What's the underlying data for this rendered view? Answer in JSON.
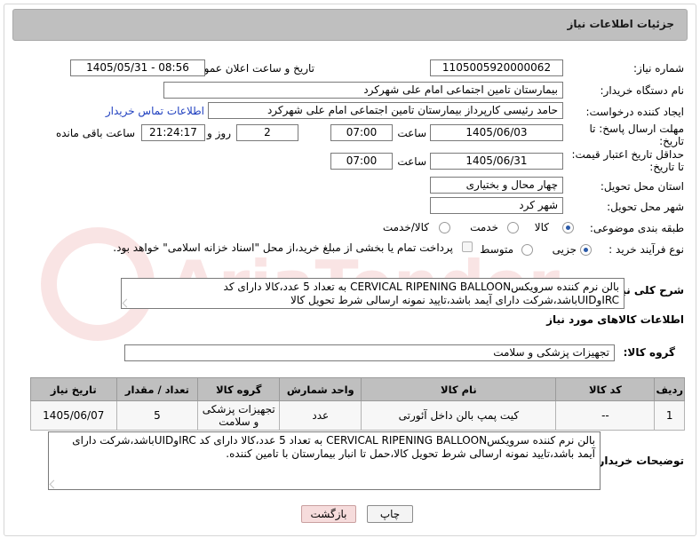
{
  "header": {
    "title": "جزئیات اطلاعات نیاز"
  },
  "fields": {
    "need_number_label": "شماره نیاز:",
    "need_number": "1105005920000062",
    "announce_label": "تاریخ و ساعت اعلان عمومی:",
    "announce_value": "1405/05/31 - 08:56",
    "buyer_org_label": "نام دستگاه خریدار:",
    "buyer_org": "بیمارستان تامین اجتماعی امام علی شهرکرد",
    "requester_label": "ایجاد کننده درخواست:",
    "requester": "حامد رئیسی کارپرداز بیمارستان تامین اجتماعی امام علی شهرکرد",
    "contact_link": "اطلاعات تماس خریدار",
    "deadline_label": "مهلت ارسال پاسخ: تا تاریخ:",
    "deadline_date": "1405/06/03",
    "time_label": "ساعت",
    "deadline_time": "07:00",
    "days_value": "2",
    "days_label": "روز و",
    "remaining_time": "21:24:17",
    "remaining_label": "ساعت باقی مانده",
    "validity_label": "حداقل تاریخ اعتبار قیمت: تا تاریخ:",
    "validity_date": "1405/06/31",
    "validity_time": "07:00",
    "province_label": "استان محل تحویل:",
    "province": "چهار محال و بختیاری",
    "city_label": "شهر محل تحویل:",
    "city": "شهر کرد",
    "category_label": "طبقه بندی موضوعی:",
    "category_options": [
      "کالا",
      "خدمت",
      "کالا/خدمت"
    ],
    "process_label": "نوع فرآیند خرید :",
    "process_options": [
      "جزیی",
      "متوسط"
    ],
    "payment_note": "پرداخت تمام یا بخشی از مبلغ خرید،از محل \"اسناد خزانه اسلامی\" خواهد بود.",
    "general_desc_label": "شرح کلی نیاز:",
    "general_desc": "بالن نرم کننده سرویکسCERVICAL RIPENING BALLOON به تعداد 5 عدد،کالا دارای کد IRCوUIDباشد،شرکت دارای آیمد باشد،تایید نمونه ارسالی شرط تحویل کالا",
    "goods_info_title": "اطلاعات کالاهای مورد نیاز",
    "goods_group_label": "گروه کالا:",
    "goods_group": "تجهیزات پزشکی و سلامت",
    "buyer_desc_label": "توضیحات خریدار:",
    "buyer_desc": "بالن نرم کننده سرویکسCERVICAL RIPENING BALLOON به تعداد 5 عدد،کالا دارای کد IRCوUIDباشد،شرکت دارای آیمد باشد،تایید نمونه ارسالی شرط تحویل کالا،حمل تا انبار بیمارستان با تامین کننده."
  },
  "table": {
    "headers": [
      "ردیف",
      "کد کالا",
      "نام کالا",
      "واحد شمارش",
      "گروه کالا",
      "تعداد / مقدار",
      "تاریخ نیاز"
    ],
    "rows": [
      [
        "1",
        "--",
        "کیت پمپ بالن داخل آئورتی",
        "عدد",
        "تجهیزات پزشکی و سلامت",
        "5",
        "1405/06/07"
      ]
    ]
  },
  "buttons": {
    "print": "چاپ",
    "back": "بازگشت"
  },
  "watermark": {
    "text": "AriaTender.net"
  },
  "colors": {
    "header_bg": "#bfbfbf",
    "link": "#1f3fbf",
    "back_btn": "#f6dcdc"
  }
}
